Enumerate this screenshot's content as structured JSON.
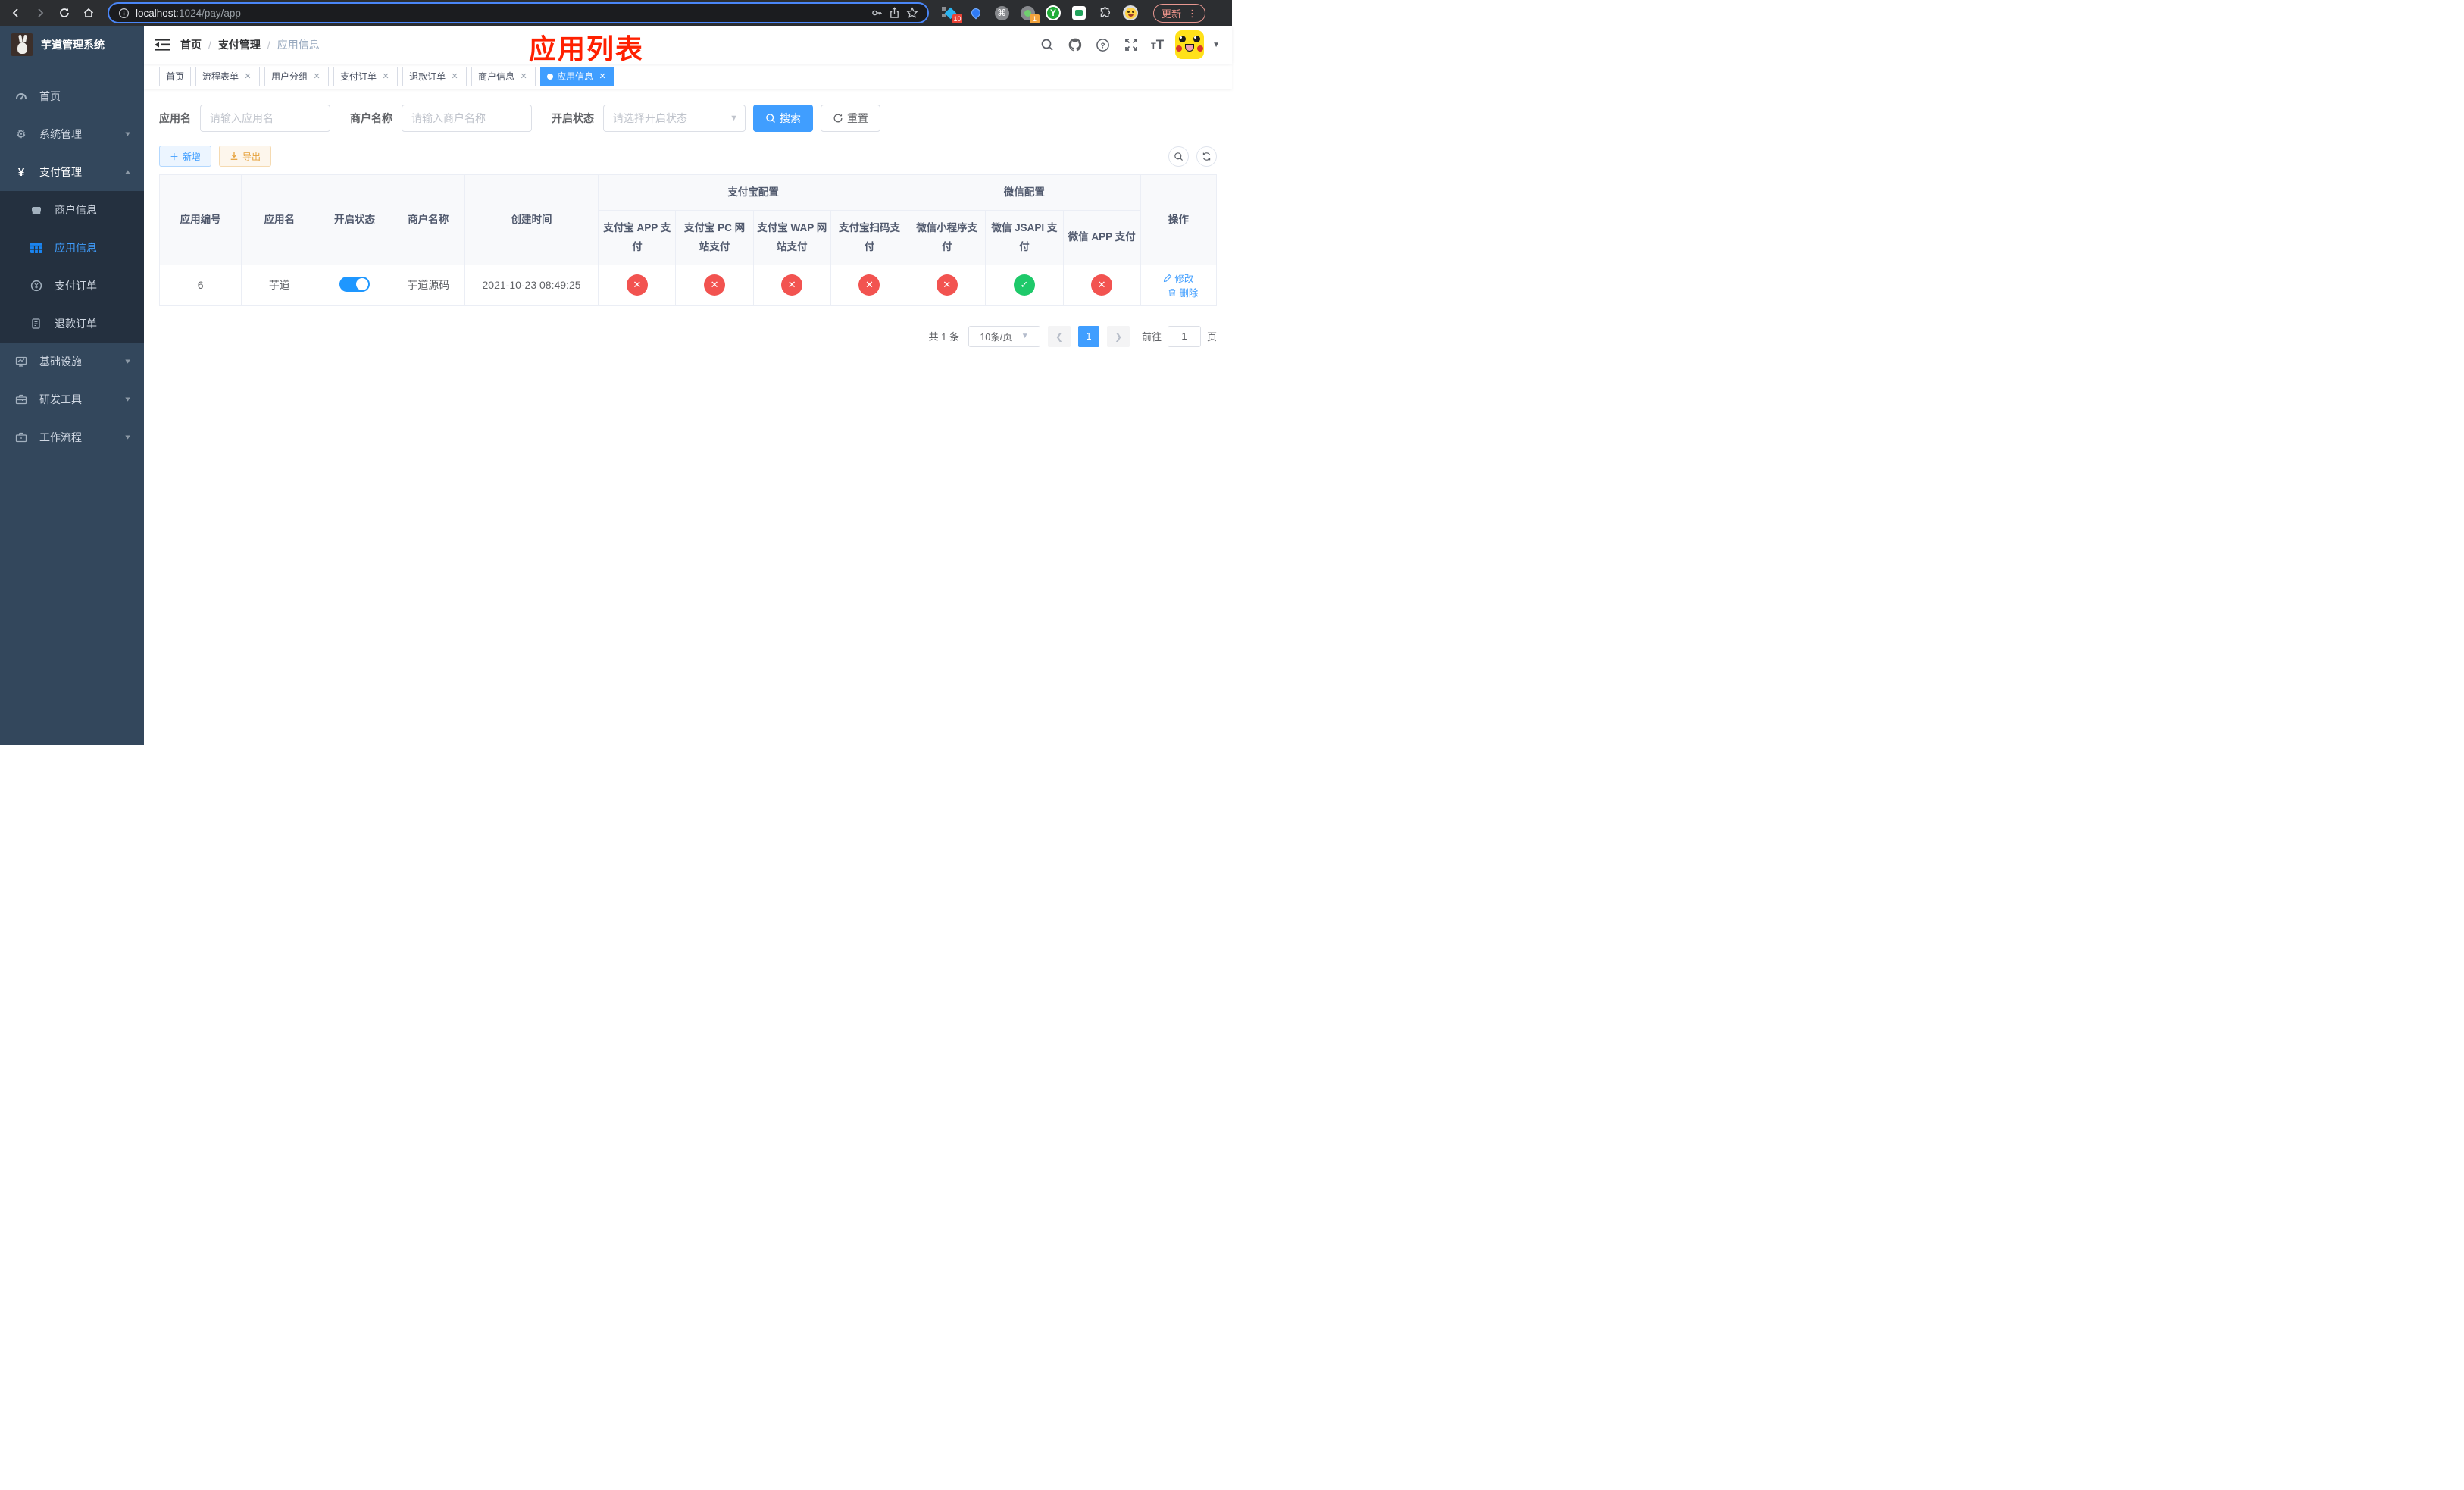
{
  "browser": {
    "url": {
      "host": "localhost",
      "rest": ":1024/pay/app"
    },
    "update_label": "更新",
    "ext_badge_10": "10",
    "ext_badge_1": "1",
    "y_ext_label": "Y"
  },
  "sidebar": {
    "title": "芋道管理系统",
    "home": "首页",
    "system": "系统管理",
    "payment": "支付管理",
    "merchant_info": "商户信息",
    "app_info": "应用信息",
    "pay_order": "支付订单",
    "refund_order": "退款订单",
    "infra": "基础设施",
    "dev_tools": "研发工具",
    "workflow": "工作流程"
  },
  "navbar": {
    "breadcrumb": {
      "home": "首页",
      "section": "支付管理",
      "current": "应用信息"
    },
    "annotation": "应用列表"
  },
  "tags": [
    {
      "label": "首页",
      "state": "inactive"
    },
    {
      "label": "流程表单",
      "state": "inactive"
    },
    {
      "label": "用户分组",
      "state": "inactive"
    },
    {
      "label": "支付订单",
      "state": "inactive"
    },
    {
      "label": "退款订单",
      "state": "inactive"
    },
    {
      "label": "商户信息",
      "state": "inactive"
    },
    {
      "label": "应用信息",
      "state": "active"
    }
  ],
  "filters": {
    "app_name_label": "应用名",
    "app_name_placeholder": "请输入应用名",
    "merchant_label": "商户名称",
    "merchant_placeholder": "请输入商户名称",
    "status_label": "开启状态",
    "status_placeholder": "请选择开启状态",
    "search_label": "搜索",
    "reset_label": "重置"
  },
  "toolbar": {
    "add_label": "新增",
    "export_label": "导出"
  },
  "table": {
    "col_id": "应用编号",
    "col_name": "应用名",
    "col_status": "开启状态",
    "col_merchant": "商户名称",
    "col_created": "创建时间",
    "group_alipay": "支付宝配置",
    "alipay_cols": [
      "支付宝 APP 支付",
      "支付宝 PC 网站支付",
      "支付宝 WAP 网站支付",
      "支付宝扫码支付"
    ],
    "group_wechat": "微信配置",
    "wechat_cols": [
      "微信小程序支付",
      "微信 JSAPI 支付",
      "微信 APP 支付"
    ],
    "col_ops": "操作",
    "row": {
      "id": "6",
      "name": "芋道",
      "enabled": "on",
      "merchant": "芋道源码",
      "created": "2021-10-23 08:49:25",
      "channels": [
        "fail",
        "fail",
        "fail",
        "fail",
        "fail",
        "pass",
        "fail"
      ],
      "edit_label": "修改",
      "delete_label": "删除"
    }
  },
  "pagination": {
    "total": "共 1 条",
    "size": "10条/页",
    "page": "1",
    "goto_label": "前往",
    "goto_value": "1",
    "unit": "页"
  },
  "colors": {
    "accent": "#409eff",
    "success": "#1ec96a",
    "danger": "#f25350",
    "sidebar": "#33475c",
    "submenu": "#24303f"
  }
}
